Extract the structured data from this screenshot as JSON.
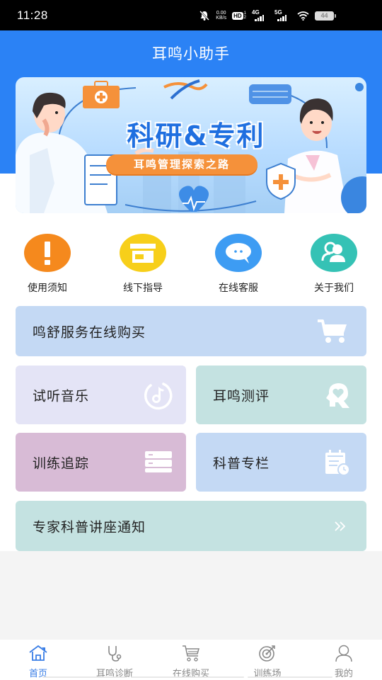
{
  "status_bar": {
    "time": "11:28",
    "net_speed_value": "0.00",
    "net_speed_unit": "KB/s",
    "hd_label": "HD",
    "hd_sub_top": "1",
    "hd_sub_bottom": "2",
    "network_1": "4G",
    "network_2": "5G",
    "battery": "44",
    "icons": [
      "mute-bell-icon",
      "hd-volte-icon",
      "signal-4g-icon",
      "signal-5g-icon",
      "wifi-icon",
      "battery-icon"
    ]
  },
  "header": {
    "title": "耳鸣小助手",
    "bg_color": "#2b82f5"
  },
  "banner": {
    "headline": "科研&专利",
    "subtitle": "耳鸣管理探索之路"
  },
  "quick_actions": [
    {
      "label": "使用须知",
      "icon": "exclamation-icon",
      "color": "#f5891d"
    },
    {
      "label": "线下指导",
      "icon": "store-icon",
      "color": "#f7cf1a"
    },
    {
      "label": "在线客服",
      "icon": "chat-bubble-icon",
      "color": "#3d9cf3"
    },
    {
      "label": "关于我们",
      "icon": "users-icon",
      "color": "#35c2b5"
    }
  ],
  "cards": {
    "purchase": {
      "label": "鸣舒服务在线购买",
      "icon": "cart-icon",
      "color": "#c4d9f4"
    },
    "music": {
      "label": "试听音乐",
      "icon": "music-note-icon",
      "color": "#e4e4f6"
    },
    "assessment": {
      "label": "耳鸣测评",
      "icon": "head-heart-icon",
      "color": "#c4e2e1"
    },
    "tracking": {
      "label": "训练追踪",
      "icon": "server-list-icon",
      "color": "#d8bbd6"
    },
    "science": {
      "label": "科普专栏",
      "icon": "calendar-clock-icon",
      "color": "#c4d9f4"
    },
    "lecture": {
      "label": "专家科普讲座通知",
      "icon": "double-chevron-right-icon",
      "color": "#c4e2e1"
    }
  },
  "bottom_nav": {
    "active_color": "#3a7ee6",
    "items": [
      {
        "label": "首页",
        "icon": "home-icon",
        "active": true
      },
      {
        "label": "耳鸣诊断",
        "icon": "stethoscope-icon",
        "active": false
      },
      {
        "label": "在线购买",
        "icon": "cart-outline-icon",
        "active": false
      },
      {
        "label": "训练场",
        "icon": "target-icon",
        "active": false
      },
      {
        "label": "我的",
        "icon": "user-icon",
        "active": false
      }
    ]
  }
}
